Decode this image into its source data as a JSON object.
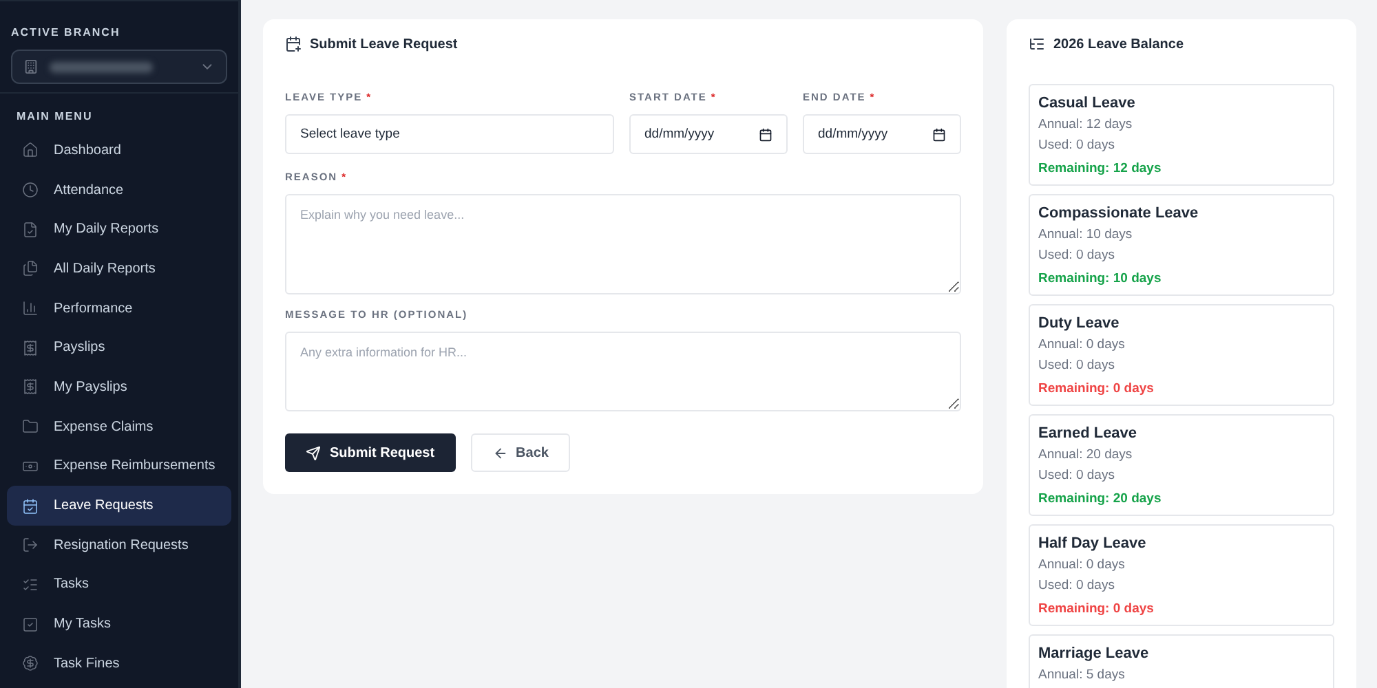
{
  "sidebar": {
    "branch_label": "ACTIVE BRANCH",
    "menu_label": "MAIN MENU",
    "items": [
      {
        "label": "Dashboard",
        "selected": false
      },
      {
        "label": "Attendance",
        "selected": false
      },
      {
        "label": "My Daily Reports",
        "selected": false
      },
      {
        "label": "All Daily Reports",
        "selected": false
      },
      {
        "label": "Performance",
        "selected": false
      },
      {
        "label": "Payslips",
        "selected": false
      },
      {
        "label": "My Payslips",
        "selected": false
      },
      {
        "label": "Expense Claims",
        "selected": false
      },
      {
        "label": "Expense Reimbursements",
        "selected": false
      },
      {
        "label": "Leave Requests",
        "selected": true
      },
      {
        "label": "Resignation Requests",
        "selected": false
      },
      {
        "label": "Tasks",
        "selected": false
      },
      {
        "label": "My Tasks",
        "selected": false
      },
      {
        "label": "Task Fines",
        "selected": false
      }
    ]
  },
  "form": {
    "title": "Submit Leave Request",
    "leave_type": {
      "label": "LEAVE TYPE",
      "required": "*",
      "value": "Select leave type"
    },
    "start_date": {
      "label": "START DATE",
      "required": "*",
      "value": "dd/mm/yyyy"
    },
    "end_date": {
      "label": "END DATE",
      "required": "*",
      "value": "dd/mm/yyyy"
    },
    "reason": {
      "label": "REASON",
      "required": "*",
      "placeholder": "Explain why you need leave..."
    },
    "message": {
      "label": "MESSAGE TO HR (OPTIONAL)",
      "placeholder": "Any extra information for HR..."
    },
    "submit": "Submit Request",
    "back": "Back"
  },
  "balance": {
    "title": "2026 Leave Balance",
    "items": [
      {
        "name": "Casual Leave",
        "annual": "Annual: 12 days",
        "used": "Used: 0 days",
        "remaining": "Remaining: 12 days",
        "kind": "available"
      },
      {
        "name": "Compassionate Leave",
        "annual": "Annual: 10 days",
        "used": "Used: 0 days",
        "remaining": "Remaining: 10 days",
        "kind": "available"
      },
      {
        "name": "Duty Leave",
        "annual": "Annual: 0 days",
        "used": "Used: 0 days",
        "remaining": "Remaining: 0 days",
        "kind": "empty"
      },
      {
        "name": "Earned Leave",
        "annual": "Annual: 20 days",
        "used": "Used: 0 days",
        "remaining": "Remaining: 20 days",
        "kind": "available"
      },
      {
        "name": "Half Day Leave",
        "annual": "Annual: 0 days",
        "used": "Used: 0 days",
        "remaining": "Remaining: 0 days",
        "kind": "empty"
      },
      {
        "name": "Marriage Leave",
        "annual": "Annual: 5 days"
      }
    ]
  }
}
